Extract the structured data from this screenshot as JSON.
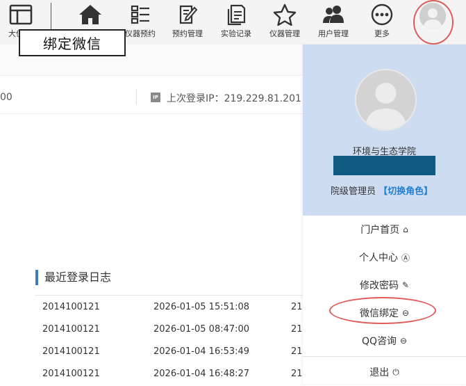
{
  "toolbar": {
    "items": [
      {
        "label": "大仪",
        "icon": "dashboard-window-icon"
      },
      {
        "label": "首页",
        "icon": "home-icon"
      },
      {
        "label": "仪器预约",
        "icon": "list-icon"
      },
      {
        "label": "预约管理",
        "icon": "edit-document-icon"
      },
      {
        "label": "实验记录",
        "icon": "record-document-icon"
      },
      {
        "label": "仪器管理",
        "icon": "star-icon"
      },
      {
        "label": "用户管理",
        "icon": "users-icon"
      },
      {
        "label": "更多",
        "icon": "more-icon"
      }
    ],
    "overlay_label": "绑定微信"
  },
  "info": {
    "left_fragment": "00",
    "ip_badge": "IP",
    "last_login_ip_label": "上次登录IP：",
    "last_login_ip": "219.229.81.201"
  },
  "login_log": {
    "title": "最近登录日志",
    "rows": [
      {
        "account": "2014100121",
        "time": "2026-01-05 15:51:08",
        "ip_fragment": "21"
      },
      {
        "account": "2014100121",
        "time": "2026-01-05 08:47:00",
        "ip_fragment": "21"
      },
      {
        "account": "2014100121",
        "time": "2026-01-04 16:53:49",
        "ip_fragment": "21"
      },
      {
        "account": "2014100121",
        "time": "2026-01-04 16:48:27",
        "ip_fragment": "21"
      }
    ]
  },
  "user_panel": {
    "department": "环境与生态学院",
    "role": "院级管理员",
    "switch_role": "【切换角色】",
    "menu": [
      {
        "label": "门户首页",
        "icon": "home-icon",
        "glyph": "⌂"
      },
      {
        "label": "个人中心",
        "icon": "user-circle-icon",
        "glyph": "Ⓐ"
      },
      {
        "label": "修改密码",
        "icon": "pencil-icon",
        "glyph": "✎"
      },
      {
        "label": "微信绑定",
        "icon": "wechat-icon",
        "glyph": "⊖"
      },
      {
        "label": "QQ咨询",
        "icon": "qq-icon",
        "glyph": "⊖"
      },
      {
        "label": "退出",
        "icon": "power-icon",
        "glyph": "⏻"
      }
    ]
  },
  "colors": {
    "accent": "#3c7cc0",
    "panel_bg": "#cddcf0",
    "highlight_ring": "#e05a5a",
    "redaction": "#0e5a80",
    "switch_role": "#1f7fd0"
  }
}
